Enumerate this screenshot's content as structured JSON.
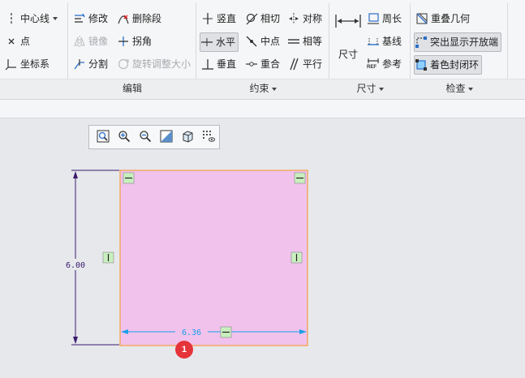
{
  "ribbon": {
    "groups": {
      "datum": {
        "items": {
          "centerline": "中心线",
          "point": "点",
          "coord_system": "坐标系"
        }
      },
      "edit": {
        "title": "编辑",
        "items": {
          "modify": "修改",
          "delete_segment": "删除段",
          "mirror": "镜像",
          "corner": "拐角",
          "divide": "分割",
          "rotate_resize": "旋转调整大小"
        }
      },
      "constrain": {
        "title": "约束",
        "items": {
          "vertical": "竖直",
          "tangent": "相切",
          "symmetric": "对称",
          "horizontal": "水平",
          "midpoint": "中点",
          "equal": "相等",
          "perpendicular": "垂直",
          "coincident": "重合",
          "parallel": "平行"
        }
      },
      "dimension": {
        "title": "尺寸",
        "items": {
          "dimension": "尺寸",
          "perimeter": "周长",
          "baseline": "基线",
          "reference": "参考",
          "ref_icon_text": "REF"
        }
      },
      "inspect": {
        "title": "检查",
        "items": {
          "overlapping_geometry": "重叠几何",
          "highlight_open_ends": "突出显示开放端",
          "shade_closed_loops": "着色封闭环"
        }
      }
    }
  },
  "sketch": {
    "dimension_height": "6.00",
    "dimension_width": "6.36",
    "fill_color": "#f0c2ec",
    "edge_color": "#f5a142",
    "dimension_color_height": "#3a1a6e",
    "dimension_color_width": "#1aa0e8",
    "marker_number": "1"
  },
  "colors": {
    "constraint_marker": "#c9efbf",
    "badge": "#e5333a"
  }
}
